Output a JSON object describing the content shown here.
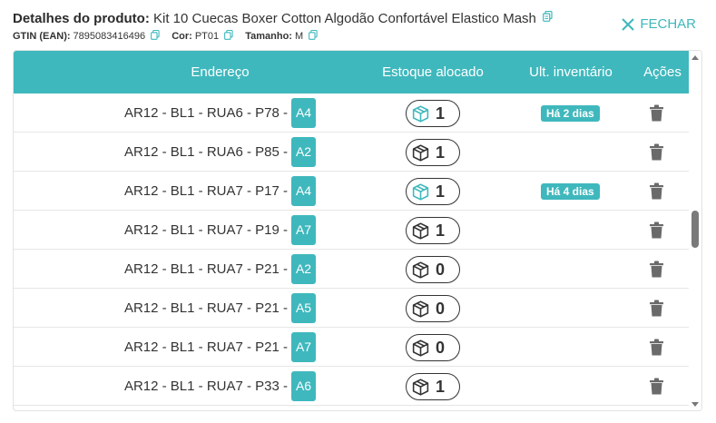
{
  "header": {
    "title_label": "Detalhes do produto:",
    "title_value": "Kit 10 Cuecas Boxer Cotton Algodão Confortável Elastico Mash",
    "gtin_label": "GTIN (EAN):",
    "gtin_value": "7895083416496",
    "cor_label": "Cor:",
    "cor_value": "PT01",
    "tamanho_label": "Tamanho:",
    "tamanho_value": "M",
    "close_label": "FECHAR"
  },
  "table": {
    "columns": {
      "endereco": "Endereço",
      "estoque": "Estoque alocado",
      "inventario": "Ult. inventário",
      "acoes": "Ações"
    },
    "rows": [
      {
        "address": "AR12 - BL1 - RUA6 - P78 -",
        "badge": "A4",
        "qty": "1",
        "inv": "Há 2 dias",
        "icon": "teal"
      },
      {
        "address": "AR12 - BL1 - RUA6 - P85 -",
        "badge": "A2",
        "qty": "1",
        "inv": "",
        "icon": "dark"
      },
      {
        "address": "AR12 - BL1 - RUA7 - P17 -",
        "badge": "A4",
        "qty": "1",
        "inv": "Há 4 dias",
        "icon": "teal"
      },
      {
        "address": "AR12 - BL1 - RUA7 - P19 -",
        "badge": "A7",
        "qty": "1",
        "inv": "",
        "icon": "dark"
      },
      {
        "address": "AR12 - BL1 - RUA7 - P21 -",
        "badge": "A2",
        "qty": "0",
        "inv": "",
        "icon": "dark"
      },
      {
        "address": "AR12 - BL1 - RUA7 - P21 -",
        "badge": "A5",
        "qty": "0",
        "inv": "",
        "icon": "dark"
      },
      {
        "address": "AR12 - BL1 - RUA7 - P21 -",
        "badge": "A7",
        "qty": "0",
        "inv": "",
        "icon": "dark"
      },
      {
        "address": "AR12 - BL1 - RUA7 - P33 -",
        "badge": "A6",
        "qty": "1",
        "inv": "",
        "icon": "dark"
      }
    ]
  },
  "colors": {
    "accent": "#3fb8bd",
    "text": "#333333"
  }
}
